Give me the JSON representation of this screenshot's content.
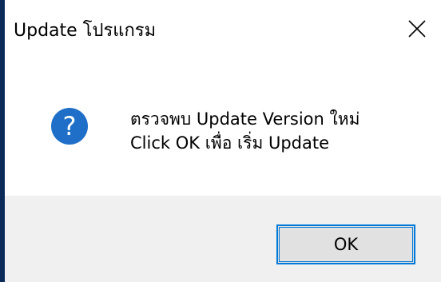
{
  "window": {
    "title": "Update โปรแกรม",
    "close_icon": "close-icon"
  },
  "message": {
    "icon": "question-icon",
    "line1": "ตรวจพบ Update Version ใหม่",
    "line2": "Click OK เพื่อ เริ่ม Update"
  },
  "buttons": {
    "ok_label": "OK"
  },
  "colors": {
    "icon_blue": "#1f6fc8",
    "focus_border": "#0078d7",
    "footer_bg": "#f0f0f0",
    "button_bg": "#e1e1e1"
  }
}
